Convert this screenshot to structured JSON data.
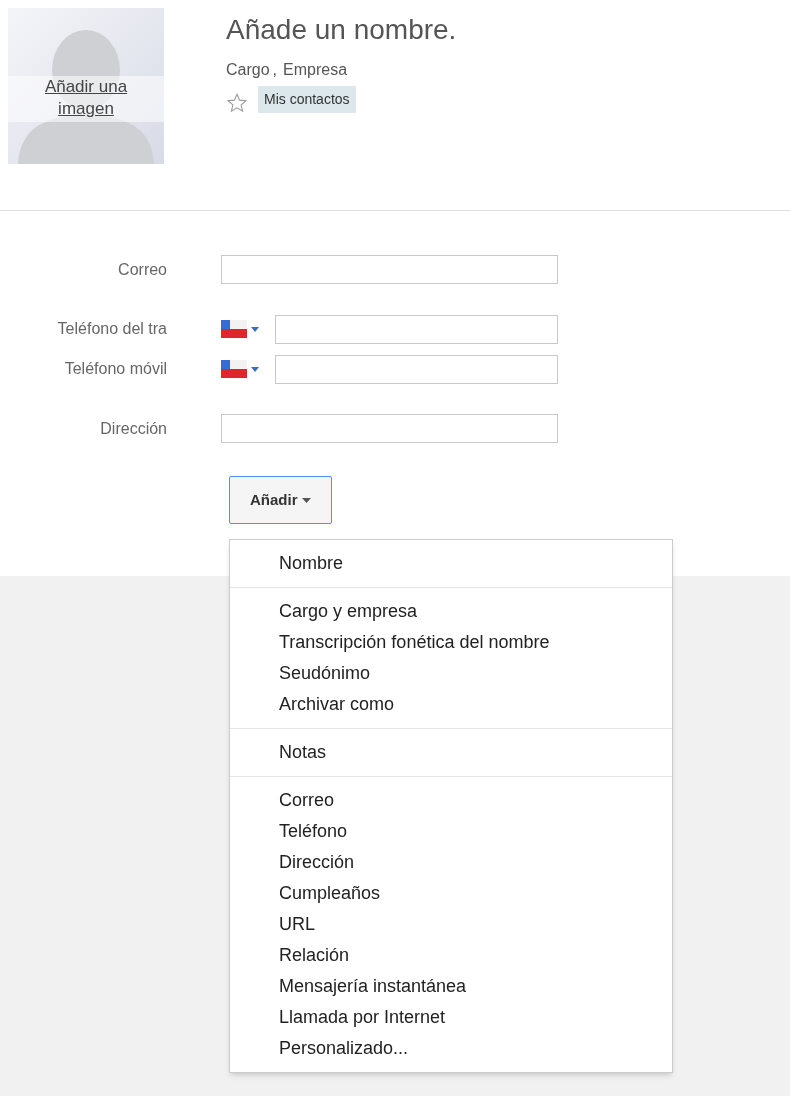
{
  "photo": {
    "link": "Añadir una imagen"
  },
  "header": {
    "name": "Añade un nombre.",
    "job_title": "Cargo",
    "separator": ",",
    "company": "Empresa",
    "starred": false,
    "group_tag": "Mis contactos"
  },
  "fields": [
    {
      "kind": "text",
      "label": "Correo"
    },
    {
      "kind": "phone",
      "label": "Teléfono del tra"
    },
    {
      "kind": "phone",
      "label": "Teléfono móvil"
    },
    {
      "kind": "text",
      "label": "Dirección"
    }
  ],
  "add_button": {
    "label": "Añadir",
    "expanded": true
  },
  "add_menu": [
    [
      "Nombre"
    ],
    [
      "Cargo y empresa",
      "Transcripción fonética del nombre",
      "Seudónimo",
      "Archivar como"
    ],
    [
      "Notas"
    ],
    [
      "Correo",
      "Teléfono",
      "Dirección",
      "Cumpleaños",
      "URL",
      "Relación",
      "Mensajería instantánea",
      "Llamada por Internet",
      "Personalizado..."
    ]
  ]
}
